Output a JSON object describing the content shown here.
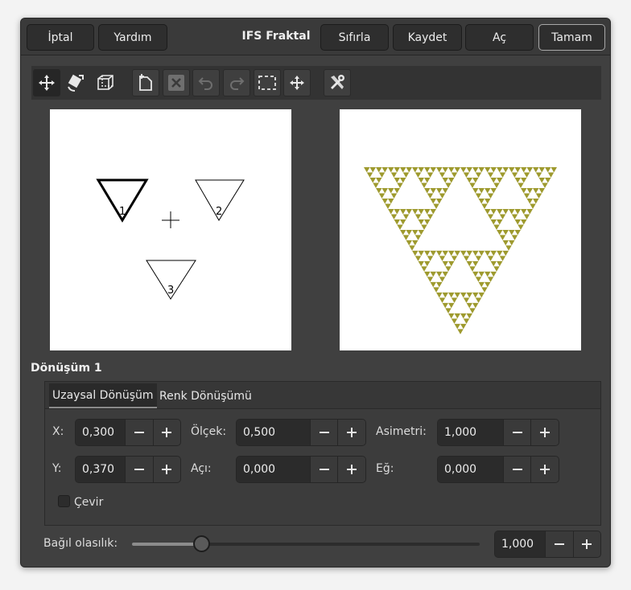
{
  "header": {
    "cancel_label": "İptal",
    "help_label": "Yardım",
    "title": "IFS Fraktal",
    "reset_label": "Sıfırla",
    "save_label": "Kaydet",
    "open_label": "Aç",
    "ok_label": "Tamam"
  },
  "toolbar": {
    "tools": [
      "move-icon",
      "rotate-scale-icon",
      "stretch-icon",
      "new-transform-icon",
      "delete-transform-icon",
      "undo-icon",
      "redo-icon",
      "select-all-icon",
      "recompute-center-icon",
      "preferences-icon"
    ]
  },
  "design_preview": {
    "triangles": [
      {
        "label": "1",
        "selected": true
      },
      {
        "label": "2",
        "selected": false
      },
      {
        "label": "3",
        "selected": false
      }
    ]
  },
  "fractal_preview": {
    "color": "#9e9a2e"
  },
  "transform": {
    "section_title": "Dönüşüm 1",
    "tabs": [
      "Uzaysal Dönüşüm",
      "Renk Dönüşümü"
    ],
    "active_tab": 0,
    "fields": {
      "x": {
        "label": "X:",
        "value": "0,300"
      },
      "y": {
        "label": "Y:",
        "value": "0,370"
      },
      "scale": {
        "label": "Ölçek:",
        "value": "0,500"
      },
      "angle": {
        "label": "Açı:",
        "value": "0,000"
      },
      "asym": {
        "label": "Asimetri:",
        "value": "1,000"
      },
      "shear": {
        "label": "Eğ:",
        "value": "0,000"
      }
    },
    "flip_label": "Çevir",
    "flip_checked": false
  },
  "probability": {
    "label": "Bağıl olasılık:",
    "value": "1,000",
    "slider_fraction": 0.2
  },
  "colors": {
    "accent_fractal": "#9e9a2e",
    "dialog_bg": "#404040"
  }
}
